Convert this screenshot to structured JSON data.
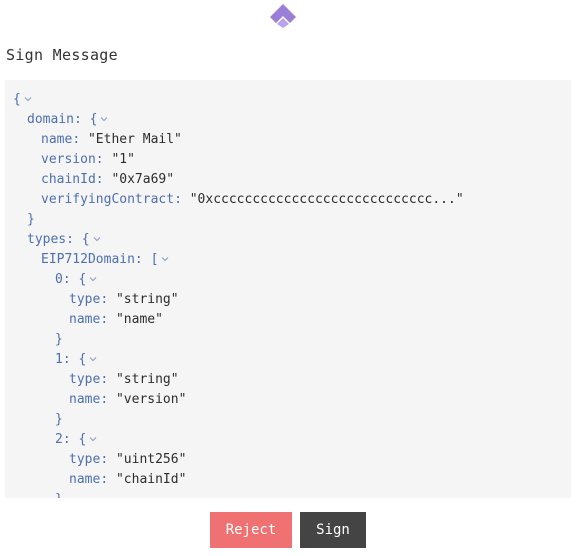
{
  "app": {
    "logo_icon": "wallet-logo-icon",
    "accent": "#9b7fd6"
  },
  "title": "Sign Message",
  "json_lines": [
    {
      "indent": 0,
      "key": "",
      "sep": "",
      "value": "{",
      "kind": "open"
    },
    {
      "indent": 1,
      "key": "domain",
      "sep": ": ",
      "value": "{",
      "kind": "open"
    },
    {
      "indent": 2,
      "key": "name",
      "sep": ": ",
      "value": "\"Ether Mail\"",
      "kind": "str"
    },
    {
      "indent": 2,
      "key": "version",
      "sep": ": ",
      "value": "\"1\"",
      "kind": "str"
    },
    {
      "indent": 2,
      "key": "chainId",
      "sep": ": ",
      "value": "\"0x7a69\"",
      "kind": "str"
    },
    {
      "indent": 2,
      "key": "verifyingContract",
      "sep": ": ",
      "value": "\"0xcccccccccccccccccccccccccccc...\"",
      "kind": "str"
    },
    {
      "indent": 1,
      "key": "",
      "sep": "",
      "value": "}",
      "kind": "close"
    },
    {
      "indent": 1,
      "key": "types",
      "sep": ": ",
      "value": "{",
      "kind": "open"
    },
    {
      "indent": 2,
      "key": "EIP712Domain",
      "sep": ": ",
      "value": "[",
      "kind": "open"
    },
    {
      "indent": 3,
      "key": "0",
      "sep": ": ",
      "value": "{",
      "kind": "open"
    },
    {
      "indent": 4,
      "key": "type",
      "sep": ": ",
      "value": "\"string\"",
      "kind": "str"
    },
    {
      "indent": 4,
      "key": "name",
      "sep": ": ",
      "value": "\"name\"",
      "kind": "str"
    },
    {
      "indent": 3,
      "key": "",
      "sep": "",
      "value": "}",
      "kind": "close"
    },
    {
      "indent": 3,
      "key": "1",
      "sep": ": ",
      "value": "{",
      "kind": "open"
    },
    {
      "indent": 4,
      "key": "type",
      "sep": ": ",
      "value": "\"string\"",
      "kind": "str"
    },
    {
      "indent": 4,
      "key": "name",
      "sep": ": ",
      "value": "\"version\"",
      "kind": "str"
    },
    {
      "indent": 3,
      "key": "",
      "sep": "",
      "value": "}",
      "kind": "close"
    },
    {
      "indent": 3,
      "key": "2",
      "sep": ": ",
      "value": "{",
      "kind": "open"
    },
    {
      "indent": 4,
      "key": "type",
      "sep": ": ",
      "value": "\"uint256\"",
      "kind": "str"
    },
    {
      "indent": 4,
      "key": "name",
      "sep": ": ",
      "value": "\"chainId\"",
      "kind": "str"
    },
    {
      "indent": 3,
      "key": "",
      "sep": "",
      "value": "}",
      "kind": "close"
    }
  ],
  "buttons": {
    "reject_label": "Reject",
    "sign_label": "Sign",
    "reject_color": "#f07171",
    "sign_color": "#444444"
  }
}
